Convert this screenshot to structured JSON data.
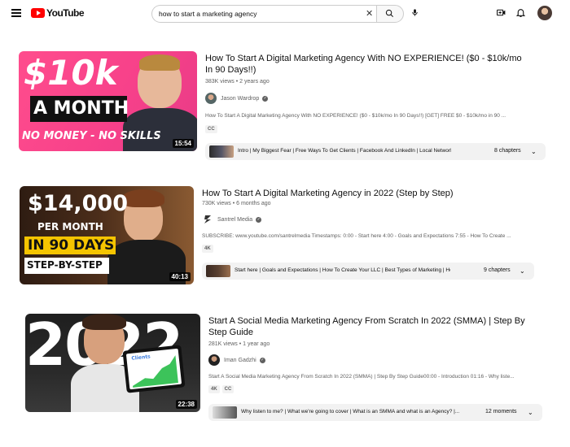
{
  "header": {
    "logo_text": "YouTube",
    "search_value": "how to start a marketing agency",
    "icons": [
      "menu-icon",
      "youtube-logo",
      "search-icon",
      "mic-icon",
      "create-icon",
      "notifications-icon",
      "account-avatar"
    ]
  },
  "results": [
    {
      "title_line1": "How To Start A Digital Marketing Agency With NO EXPERIENCE! ($0 - $10k/mo",
      "title_line2": "In 90 Days!!)",
      "meta": "383K views • 2 years ago",
      "channel": "Jason Wardrop",
      "description": "How To Start A Digital Marketing Agency With NO EXPERIENCE! ($0 - $10k/mo In 90 Days!!) [GET] FREE $0 - $10k/mo in 90 ...",
      "badges": [
        "CC"
      ],
      "chapters_text": "Intro | My Biggest Fear | Free Ways To Get Clients | Facebook And LinkedIn | Local Networking...",
      "chapters_count": "8 chapters",
      "duration": "15:54",
      "thumb_text": {
        "line1": "$10k",
        "line2": "A MONTH",
        "line3": "NO MONEY - NO SKILLS"
      }
    },
    {
      "title_line1": "How To Start A Digital Marketing Agency in 2022 (Step by Step)",
      "meta": "730K views • 6 months ago",
      "channel": "Santrel Media",
      "description": "SUBSCRIBE: www.youtube.com/santrelmedia Timestamps: 0:00 - Start here 4:00 - Goals and Expectations 7:55 - How To Create ...",
      "badges": [
        "4K"
      ],
      "chapters_text": "Start here | Goals and Expectations | How To Create Your LLC | Best Types of Marketing | How...",
      "chapters_count": "9 chapters",
      "duration": "40:13",
      "thumb_text": {
        "line1": "$14,000",
        "line2": "PER MONTH",
        "line3": "IN 90 DAYS",
        "line4": "STEP-BY-STEP"
      }
    },
    {
      "title_line1": "Start A Social Media Marketing Agency From Scratch In 2022 (SMMA) | Step By",
      "title_line2": "Step Guide",
      "meta": "281K views • 1 year ago",
      "channel": "Iman Gadzhi",
      "description": "Start A Social Media Marketing Agency From Scratch In 2022 (SMMA) | Step By Step Guide00:00 - Introduction 01:16 - Why liste...",
      "badges": [
        "4K",
        "CC"
      ],
      "chapters_text": "Why listen to me? | What we're going to cover | What is an SMMA and what is an Agency? |...",
      "chapters_count": "12 moments",
      "duration": "22:38",
      "thumb_text": {
        "line1": "2022",
        "tablet": "Clients"
      }
    }
  ]
}
